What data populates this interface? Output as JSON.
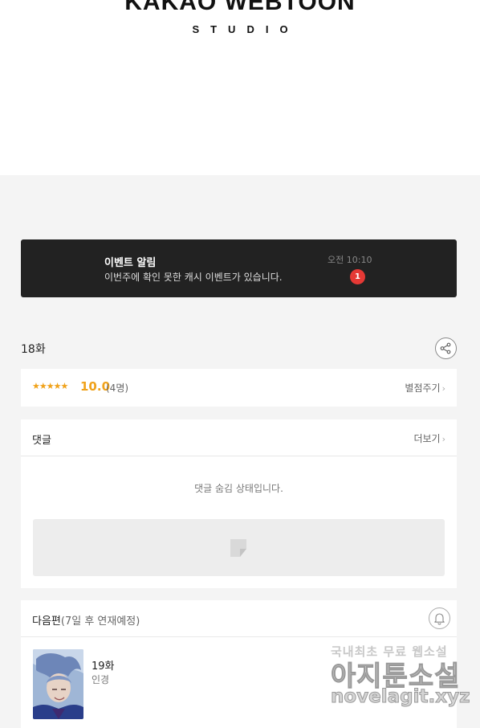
{
  "brand": {
    "wordmark": "KAKAO WEBTOON",
    "sub": "STUDIO"
  },
  "event_banner": {
    "title": "이벤트 알림",
    "message": "이번주에 확인 못한 캐시 이벤트가 있습니다.",
    "time": "오전 10:10",
    "badge_count": "1"
  },
  "episode": {
    "title": "18화"
  },
  "rating": {
    "stars": "★★★★★",
    "score": "10.0",
    "count": "(4명)",
    "rate_label": "별점주기"
  },
  "comments": {
    "title": "댓글",
    "more_label": "더보기",
    "hidden_message": "댓글 숨김 상태입니다."
  },
  "next_episode": {
    "title": "다음편",
    "schedule": "(7일 후 연재예정)",
    "episode_title": "19화",
    "episode_subtitle": "인경"
  },
  "watermark": {
    "line1": "국내최초 무료 웹소설",
    "line2": "아지툰소설",
    "line3": "novelagit.xyz"
  },
  "icons": {
    "share": "share-icon",
    "bell": "bell-icon",
    "chevron": "chevron-right-icon",
    "ad": "ad-placeholder-icon"
  },
  "colors": {
    "accent_orange": "#f0a21b",
    "badge_red": "#e53935",
    "banner_bg": "#222222",
    "page_bg": "#f4f4f4"
  }
}
